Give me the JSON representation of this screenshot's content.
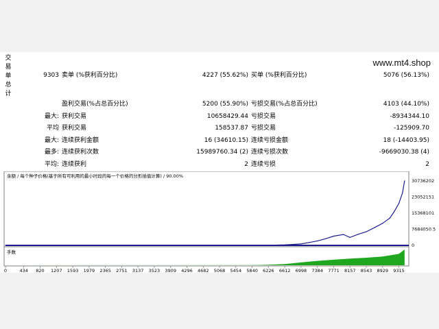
{
  "side_label": [
    "交",
    "易",
    "单",
    "总",
    "计"
  ],
  "watermark": "www.mt4.shop",
  "stats": {
    "total_trades": "9303",
    "short_label": "卖单 (%获利百分比)",
    "short_value": "4227 (55.62%)",
    "long_label": "买单 (%获利百分比)",
    "long_value": "5076 (56.13%)",
    "profit_trades_label": "盈利交易(%占总百分比)",
    "profit_trades_value": "5200 (55.90%)",
    "loss_trades_label": "亏损交易(%占总百分比)",
    "loss_trades_value": "4103 (44.10%)",
    "largest_prefix": "最大:",
    "largest_profit_label": "获利交易",
    "largest_profit_value": "10658429.44",
    "largest_loss_label": "亏损交易",
    "largest_loss_value": "-8934344.10",
    "average_prefix": "平均",
    "average_profit_label": "获利交易",
    "average_profit_value": "158537.87",
    "average_loss_label": "亏损交易",
    "average_loss_value": "-125909.70",
    "max_prefix": "最大:",
    "max_consec_wins_label": "连续获利金额",
    "max_consec_wins_value": "16 (34610.15)",
    "max_consec_losses_label": "连续亏损金额",
    "max_consec_losses_value": "18 (-14403.95)",
    "most_prefix": "最多:",
    "max_consec_profit_label": "连续获利次数",
    "max_consec_profit_value": "15989760.34 (2)",
    "max_consec_loss_label": "连续亏损次数",
    "max_consec_loss_value": "-9669030.38 (4)",
    "avg_prefix": "平均:",
    "avg_consec_wins_label": "连续获利",
    "avg_consec_wins_value": "2",
    "avg_consec_losses_label": "连续亏损",
    "avg_consec_losses_value": "2"
  },
  "chart_data": {
    "type": "line",
    "title": "余额 / 每个种子价格(基于所有可利用的最小时段的每一个价格的分形插值计算) / 90.00%",
    "subchart_label": "手数",
    "y_ticks": [
      "30736202",
      "23052151",
      "15368101",
      "7684050.5",
      "0"
    ],
    "y_tick_values": [
      30736202,
      23052151,
      15368101,
      7684050.5,
      0
    ],
    "ylim": [
      0,
      32000000
    ],
    "x_ticks": [
      "0",
      "434",
      "820",
      "1207",
      "1593",
      "1979",
      "2365",
      "2751",
      "3137",
      "3523",
      "3909",
      "4296",
      "4682",
      "5068",
      "5454",
      "5840",
      "6226",
      "6612",
      "6998",
      "7384",
      "7771",
      "8157",
      "8543",
      "8929",
      "9315"
    ],
    "xlim": [
      0,
      9550
    ],
    "series": [
      {
        "color": "#1a1a8c",
        "x": [
          0,
          434,
          820,
          1207,
          1593,
          1979,
          2365,
          2751,
          3137,
          3523,
          3909,
          4296,
          4682,
          5068,
          5454,
          5840,
          6226,
          6612,
          6800,
          6998,
          7200,
          7384,
          7600,
          7771,
          8000,
          8157,
          8350,
          8543,
          8750,
          8929,
          9100,
          9200,
          9315,
          9400,
          9450
        ],
        "values": [
          0,
          0,
          0,
          0,
          0,
          0,
          0,
          0,
          0,
          0,
          0,
          0,
          0,
          0,
          0,
          10000,
          80000,
          250000,
          450000,
          700000,
          1400000,
          2100000,
          3300000,
          4400000,
          5200000,
          3800000,
          5300000,
          6500000,
          8600000,
          10500000,
          13000000,
          16000000,
          20000000,
          25000000,
          30736202
        ]
      }
    ],
    "volume_color": "#1fa81f",
    "volume_x": [
      0,
      5840,
      6226,
      6612,
      6998,
      7384,
      7771,
      8157,
      8543,
      8929,
      9315,
      9450
    ],
    "volume_values": [
      0,
      0.01,
      0.03,
      0.08,
      0.18,
      0.28,
      0.35,
      0.42,
      0.48,
      0.55,
      0.72,
      1.0
    ],
    "grid": false
  }
}
